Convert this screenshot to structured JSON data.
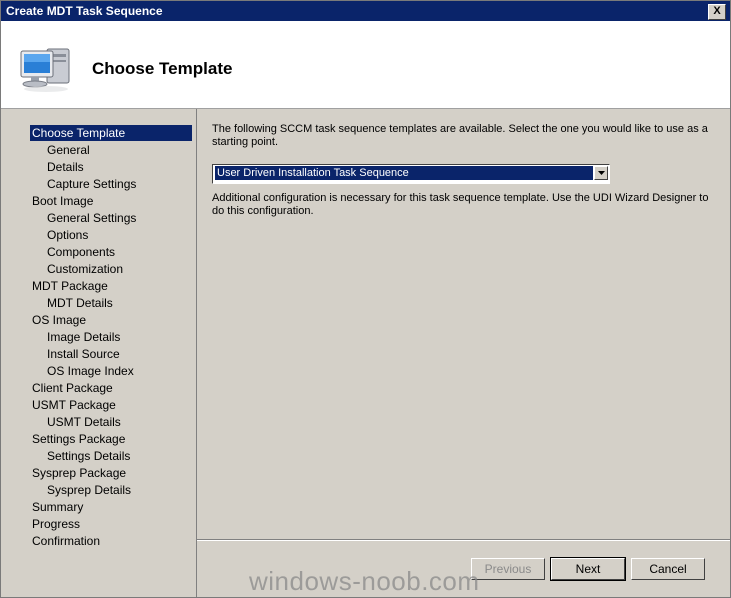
{
  "window": {
    "title": "Create MDT Task Sequence",
    "close_label": "X"
  },
  "header": {
    "title": "Choose Template",
    "icon": "computer-icon"
  },
  "nav": {
    "items": [
      {
        "label": "Choose Template",
        "level": 0,
        "selected": true
      },
      {
        "label": "General",
        "level": 1
      },
      {
        "label": "Details",
        "level": 1
      },
      {
        "label": "Capture Settings",
        "level": 1
      },
      {
        "label": "Boot Image",
        "level": 0
      },
      {
        "label": "General Settings",
        "level": 1
      },
      {
        "label": "Options",
        "level": 1
      },
      {
        "label": "Components",
        "level": 1
      },
      {
        "label": "Customization",
        "level": 1
      },
      {
        "label": "MDT Package",
        "level": 0
      },
      {
        "label": "MDT Details",
        "level": 1
      },
      {
        "label": "OS Image",
        "level": 0
      },
      {
        "label": "Image Details",
        "level": 1
      },
      {
        "label": "Install Source",
        "level": 1
      },
      {
        "label": "OS Image Index",
        "level": 1
      },
      {
        "label": "Client Package",
        "level": 0
      },
      {
        "label": "USMT Package",
        "level": 0
      },
      {
        "label": "USMT Details",
        "level": 1
      },
      {
        "label": "Settings Package",
        "level": 0
      },
      {
        "label": "Settings Details",
        "level": 1
      },
      {
        "label": "Sysprep Package",
        "level": 0
      },
      {
        "label": "Sysprep Details",
        "level": 1
      },
      {
        "label": "Summary",
        "level": 0
      },
      {
        "label": "Progress",
        "level": 0
      },
      {
        "label": "Confirmation",
        "level": 0
      }
    ]
  },
  "content": {
    "intro": "The following SCCM task sequence templates are available.  Select the one you would like to use as a starting point.",
    "template_select": {
      "value": "User Driven Installation Task Sequence"
    },
    "note": "Additional configuration is necessary for this task sequence template.  Use the UDI Wizard Designer to do this configuration."
  },
  "buttons": {
    "previous": "Previous",
    "next": "Next",
    "cancel": "Cancel"
  },
  "watermark": "windows-noob.com"
}
